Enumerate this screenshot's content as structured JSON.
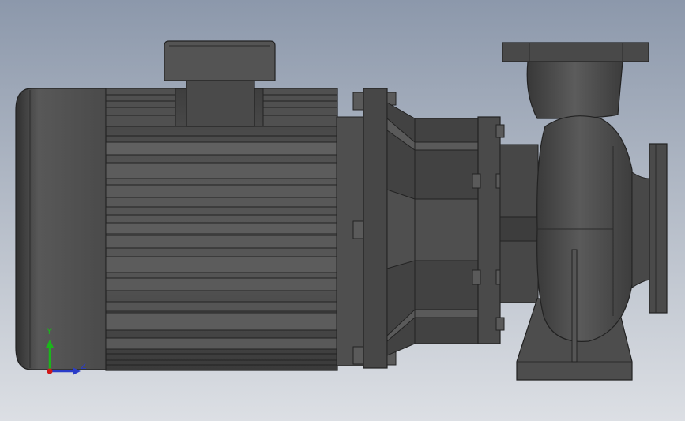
{
  "viewport": {
    "background_top": "#8c98ab",
    "background_bottom": "#dcdfe4",
    "model_color": "#4d4d4d"
  },
  "model": {
    "subject": "centrifugal-pump-with-motor",
    "parts": [
      "motor-body",
      "motor-end-cap",
      "terminal-box",
      "motor-flange",
      "bearing-bracket",
      "pump-volute",
      "discharge-flange",
      "suction-flange",
      "pump-foot"
    ]
  },
  "triad": {
    "y_label": "Y",
    "z_label": "Z",
    "y_color": "#1bb51b",
    "z_color": "#2a3cc8",
    "x_color": "#d01818"
  }
}
